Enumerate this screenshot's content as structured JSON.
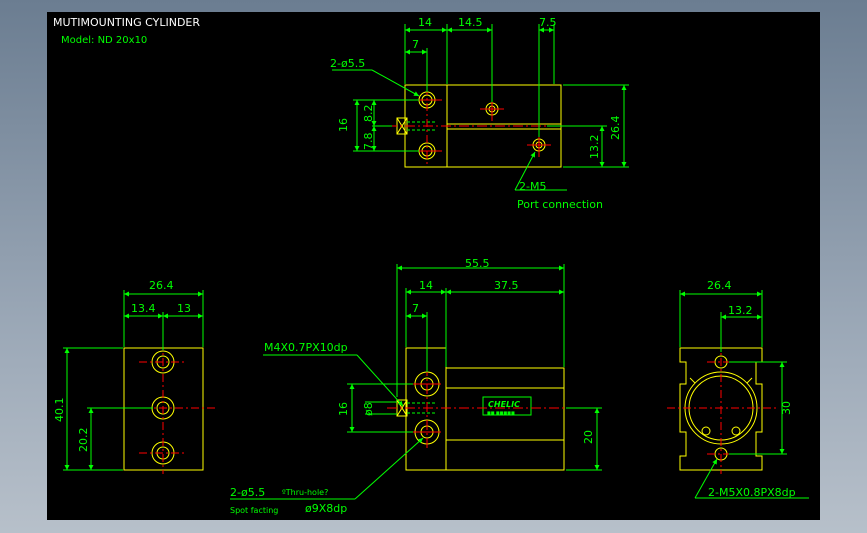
{
  "title": "MUTIMOUNTING CYLINDER",
  "model": "Model:  ND  20x10",
  "colors": {
    "background": "#000000",
    "outline": "#ffff00",
    "dimension": "#00ff00",
    "centerline": "#ff0000",
    "note": "#ffffff"
  },
  "top_view": {
    "dims": {
      "d14": "14",
      "d14_5": "14.5",
      "d7_5": "7.5",
      "d7": "7",
      "d16": "16",
      "d8_2": "8.2",
      "d7_8": "7.8",
      "d26_4": "26.4",
      "d13_2": "13.2"
    },
    "note_holes": "2-ø5.5",
    "note_port": "2-M5",
    "note_port_desc": "Port  connection"
  },
  "front_view": {
    "dims": {
      "d26_4": "26.4",
      "d13_4": "13.4",
      "d13": "13",
      "d40_1": "40.1",
      "d20_2": "20.2"
    }
  },
  "side_view": {
    "dims": {
      "d55_5": "55.5",
      "d14": "14",
      "d37_5": "37.5",
      "d7": "7",
      "d16": "16",
      "d8": "ø8",
      "d20": "20"
    },
    "note_thread": "M4X0.7PX10dp",
    "note_holes": "2-ø5.5",
    "note_thru": "ºThru-hole?",
    "note_spot": "Spot  facting",
    "note_spot_dim": "ø9X8dp",
    "label_brand": "CHELIC",
    "label_small": "■■ ■■■■■"
  },
  "right_view": {
    "dims": {
      "d26_4": "26.4",
      "d13_2": "13.2",
      "d30": "30"
    },
    "note_thread": "2-M5X0.8PX8dp"
  }
}
